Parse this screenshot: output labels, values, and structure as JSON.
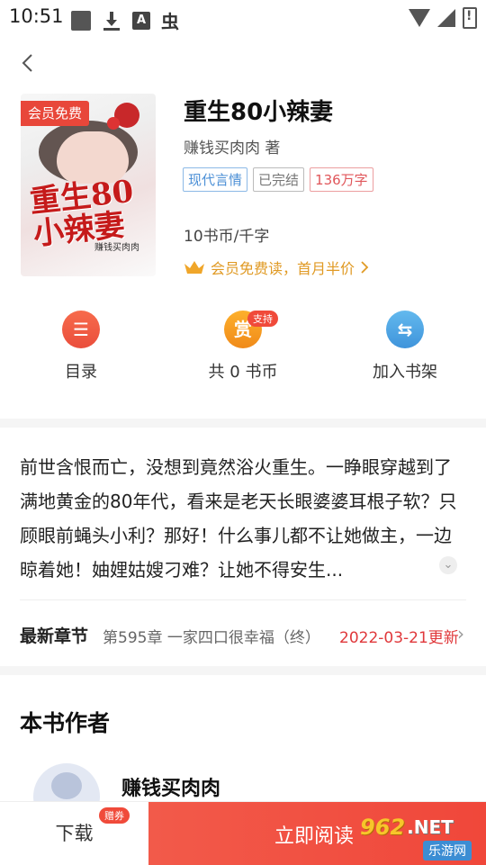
{
  "status_bar": {
    "time": "10:51",
    "a_icon_text": "A",
    "bug_text": "虫"
  },
  "book": {
    "title": "重生80小辣妻",
    "author_line": "赚钱买肉肉 著",
    "tags": [
      "现代言情",
      "已完结",
      "136万字"
    ],
    "price": "10书币/千字",
    "vip_text": "会员免费读，首月半价",
    "member_badge": "会员免费",
    "cover_title": "重生80小辣妻",
    "cover_author": "赚钱买肉肉"
  },
  "actions": {
    "toc": {
      "icon_char": "☰",
      "label": "目录"
    },
    "reward": {
      "icon_char": "赏",
      "label": "共 0 书币",
      "badge": "支持"
    },
    "shelf": {
      "icon_char": "⇆",
      "label": "加入书架"
    }
  },
  "description": "前世含恨而亡，没想到竟然浴火重生。一睁眼穿越到了满地黄金的80年代，看来是老天长眼婆婆耳根子软？只顾眼前蝇头小利？那好！什么事儿都不让她做主，一边晾着她！妯娌姑嫂刁难？让她不得安生...",
  "latest": {
    "label": "最新章节",
    "chapter": "第595章 一家四口很幸福（终）",
    "date": "2022-03-21更新"
  },
  "author_section": {
    "heading": "本书作者",
    "name": "赚钱买肉肉"
  },
  "bottom_bar": {
    "download": "下载",
    "coupon_badge": "赠券",
    "read": "立即阅读"
  },
  "watermark": {
    "brand_num": "962",
    "brand_net": ".NET",
    "brand_cn": "乐游网"
  },
  "colors": {
    "accent_red": "#f0473a",
    "vip_gold": "#e09a24",
    "date_red": "#e0383b"
  }
}
